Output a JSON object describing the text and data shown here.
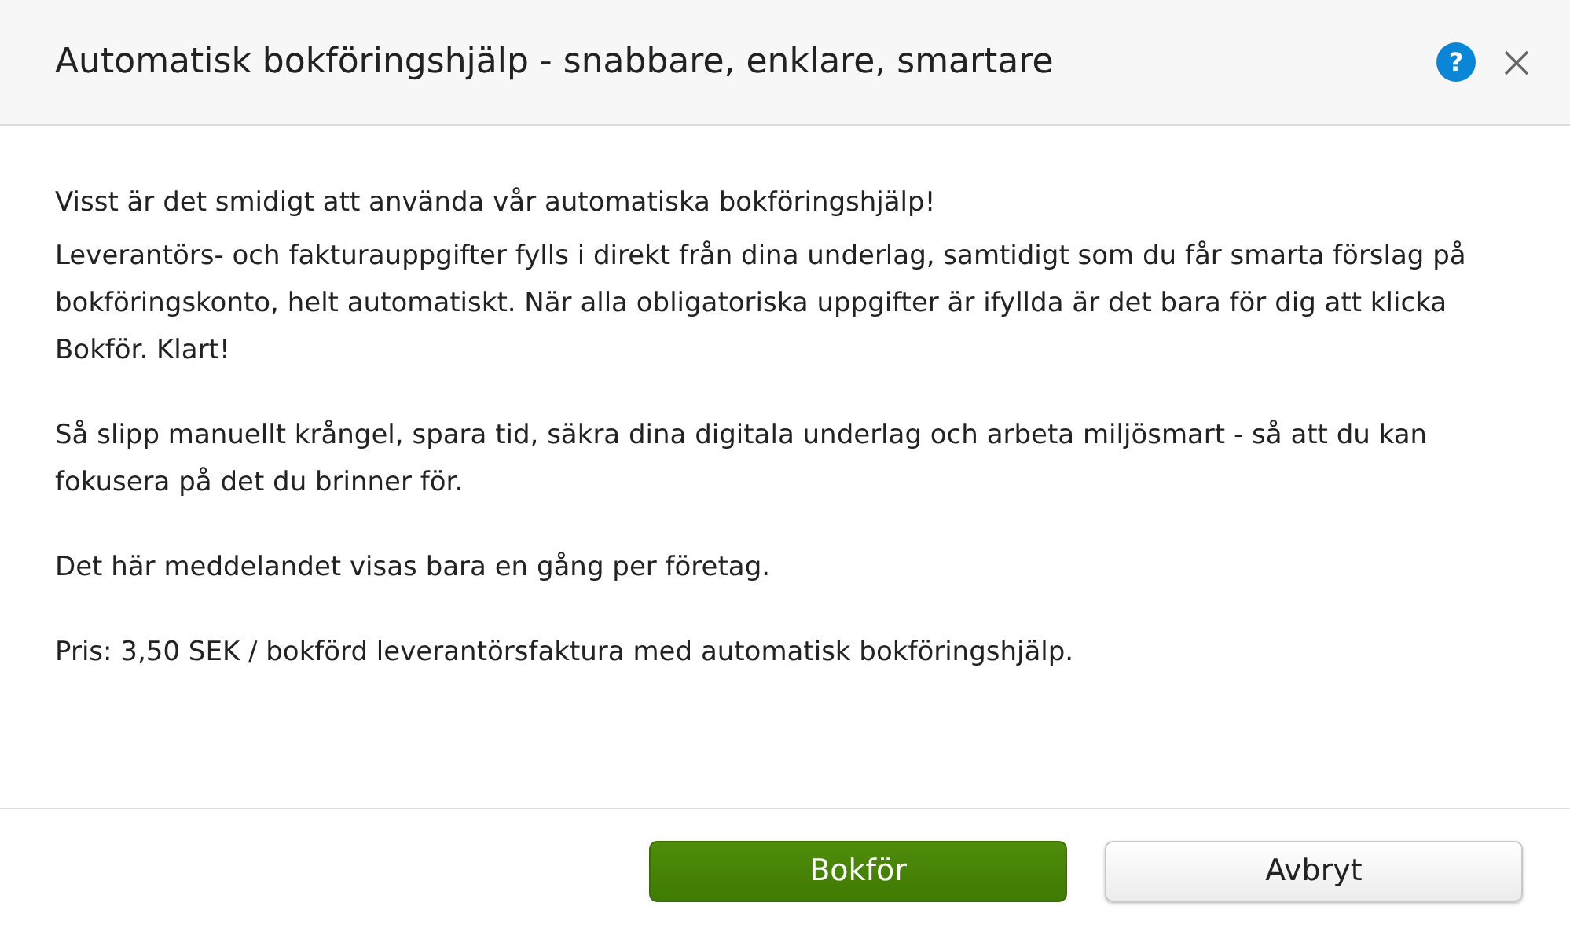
{
  "dialog": {
    "title": "Automatisk bokföringshjälp - snabbare, enklare, smartare",
    "help": "?"
  },
  "sections": [
    {
      "paragraphs": [
        "Visst är det smidigt att använda vår automatiska bokföringshjälp!",
        "Leverantörs- och fakturauppgifter fylls i direkt från dina underlag, samtidigt som du får smarta förslag på bokföringskonto, helt automatiskt. När alla obligatoriska uppgifter är ifyllda är det bara för dig att klicka Bokför. Klart!"
      ]
    },
    {
      "paragraphs": [
        "Så slipp manuellt krångel, spara tid, säkra dina digitala underlag och arbeta miljösmart - så att du kan fokusera på det du brinner för."
      ]
    },
    {
      "paragraphs": [
        "Det här meddelandet visas bara en gång per företag."
      ]
    },
    {
      "paragraphs": [
        "Pris: 3,50 SEK / bokförd leverantörsfaktura med automatisk bokföringshjälp."
      ]
    }
  ],
  "buttons": [
    {
      "label": "Bokför",
      "kind": "primary"
    },
    {
      "label": "Avbryt",
      "kind": "secondary"
    }
  ]
}
